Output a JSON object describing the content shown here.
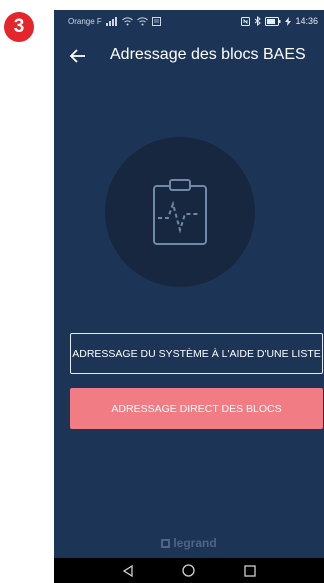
{
  "step_number": "3",
  "status_bar": {
    "carrier": "Orange F",
    "time": "14:36"
  },
  "header": {
    "title": "Adressage des blocs BAES"
  },
  "hero": {
    "icon": "clipboard-pulse-icon"
  },
  "actions": {
    "list_label": "ADRESSAGE DU SYSTÈME À L'AIDE D'UNE LISTE",
    "direct_label": "ADRESSAGE DIRECT DES BLOCS"
  },
  "brand": {
    "name": "legrand"
  },
  "colors": {
    "background": "#1c3557",
    "accent": "#f27c83",
    "badge": "#e3262b"
  }
}
